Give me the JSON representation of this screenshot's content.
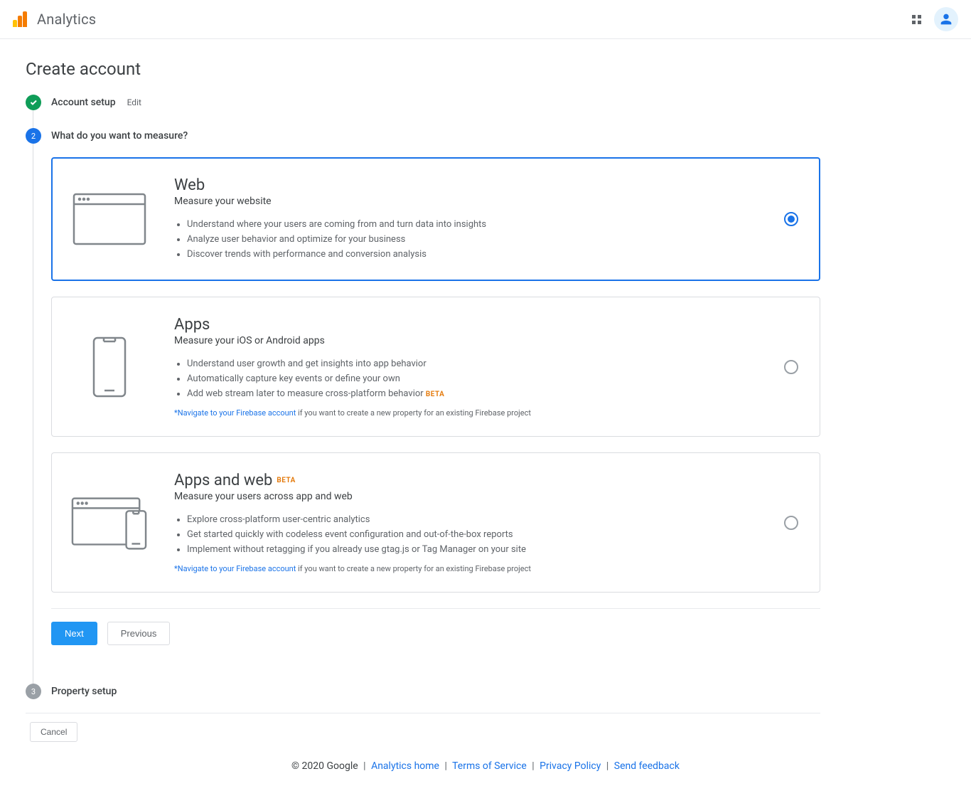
{
  "header": {
    "app_name": "Analytics"
  },
  "page": {
    "title": "Create account"
  },
  "stepper": {
    "step1": {
      "title": "Account setup",
      "edit": "Edit"
    },
    "step2": {
      "title": "What do you want to measure?",
      "number": "2"
    },
    "step3": {
      "title": "Property setup",
      "number": "3"
    }
  },
  "options": {
    "web": {
      "title": "Web",
      "subtitle": "Measure your website",
      "bullets": [
        "Understand where your users are coming from and turn data into insights",
        "Analyze user behavior and optimize for your business",
        "Discover trends with performance and conversion analysis"
      ]
    },
    "apps": {
      "title": "Apps",
      "subtitle": "Measure your iOS or Android apps",
      "bullets": [
        "Understand user growth and get insights into app behavior",
        "Automatically capture key events or define your own",
        "Add web stream later to measure cross-platform behavior"
      ],
      "beta": "BETA",
      "note_link": "*Navigate to your Firebase account",
      "note_rest": " if you want to create a new property for an existing Firebase project"
    },
    "appsweb": {
      "title": "Apps and web",
      "beta": "BETA",
      "subtitle": "Measure your users across app and web",
      "bullets": [
        "Explore cross-platform user-centric analytics",
        "Get started quickly with codeless event configuration and out-of-the-box reports",
        "Implement without retagging if you already use gtag.js or Tag Manager on your site"
      ],
      "note_link": "*Navigate to your Firebase account",
      "note_rest": " if you want to create a new property for an existing Firebase project"
    }
  },
  "buttons": {
    "next": "Next",
    "previous": "Previous",
    "cancel": "Cancel"
  },
  "footer": {
    "copyright": "© 2020 Google",
    "links": {
      "home": "Analytics home",
      "tos": "Terms of Service",
      "privacy": "Privacy Policy",
      "feedback": "Send feedback"
    }
  }
}
